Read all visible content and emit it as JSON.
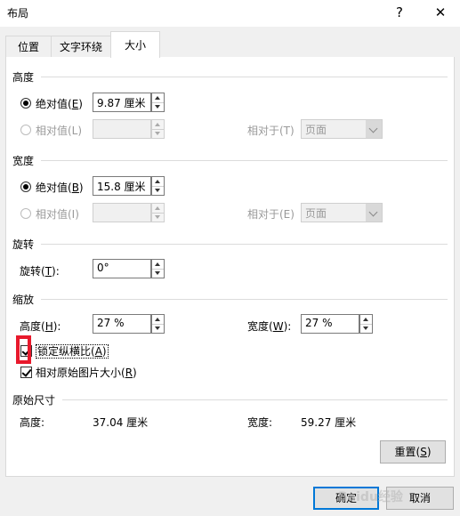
{
  "window": {
    "title": "布局",
    "help_glyph": "?",
    "close_glyph": "✕"
  },
  "tabs": [
    {
      "label": "位置"
    },
    {
      "label": "文字环绕"
    },
    {
      "label": "大小"
    }
  ],
  "height": {
    "section_title": "高度",
    "absolute_label": "绝对值(",
    "absolute_key": "E",
    "absolute_value": "9.87 厘米",
    "relative_label": "相对值(L)",
    "relative_to_label": "相对于(T)",
    "relative_to_value": "页面"
  },
  "width": {
    "section_title": "宽度",
    "absolute_label": "绝对值(",
    "absolute_key": "B",
    "absolute_value": "15.8 厘米",
    "relative_label": "相对值(I)",
    "relative_to_label": "相对于(E)",
    "relative_to_value": "页面"
  },
  "rotation": {
    "section_title": "旋转",
    "label": "旋转(",
    "key": "T",
    "value": "0°"
  },
  "scale": {
    "section_title": "缩放",
    "height_label": "高度(",
    "height_key": "H",
    "height_value": "27 %",
    "width_label": "宽度(",
    "width_key": "W",
    "width_value": "27 %",
    "lock_aspect_label": "锁定纵横比(",
    "lock_aspect_key": "A",
    "relative_original_label": "相对原始图片大小(",
    "relative_original_key": "R"
  },
  "original": {
    "section_title": "原始尺寸",
    "height_label": "高度:",
    "height_value": "37.04 厘米",
    "width_label": "宽度:",
    "width_value": "59.27 厘米"
  },
  "buttons": {
    "reset_label": "重置(",
    "reset_key": "S",
    "ok_label": "确定",
    "cancel_label": "取消"
  },
  "watermark": "Baidu经验",
  "colors": {
    "accent": "#0078d7",
    "highlight": "#e8192c"
  }
}
